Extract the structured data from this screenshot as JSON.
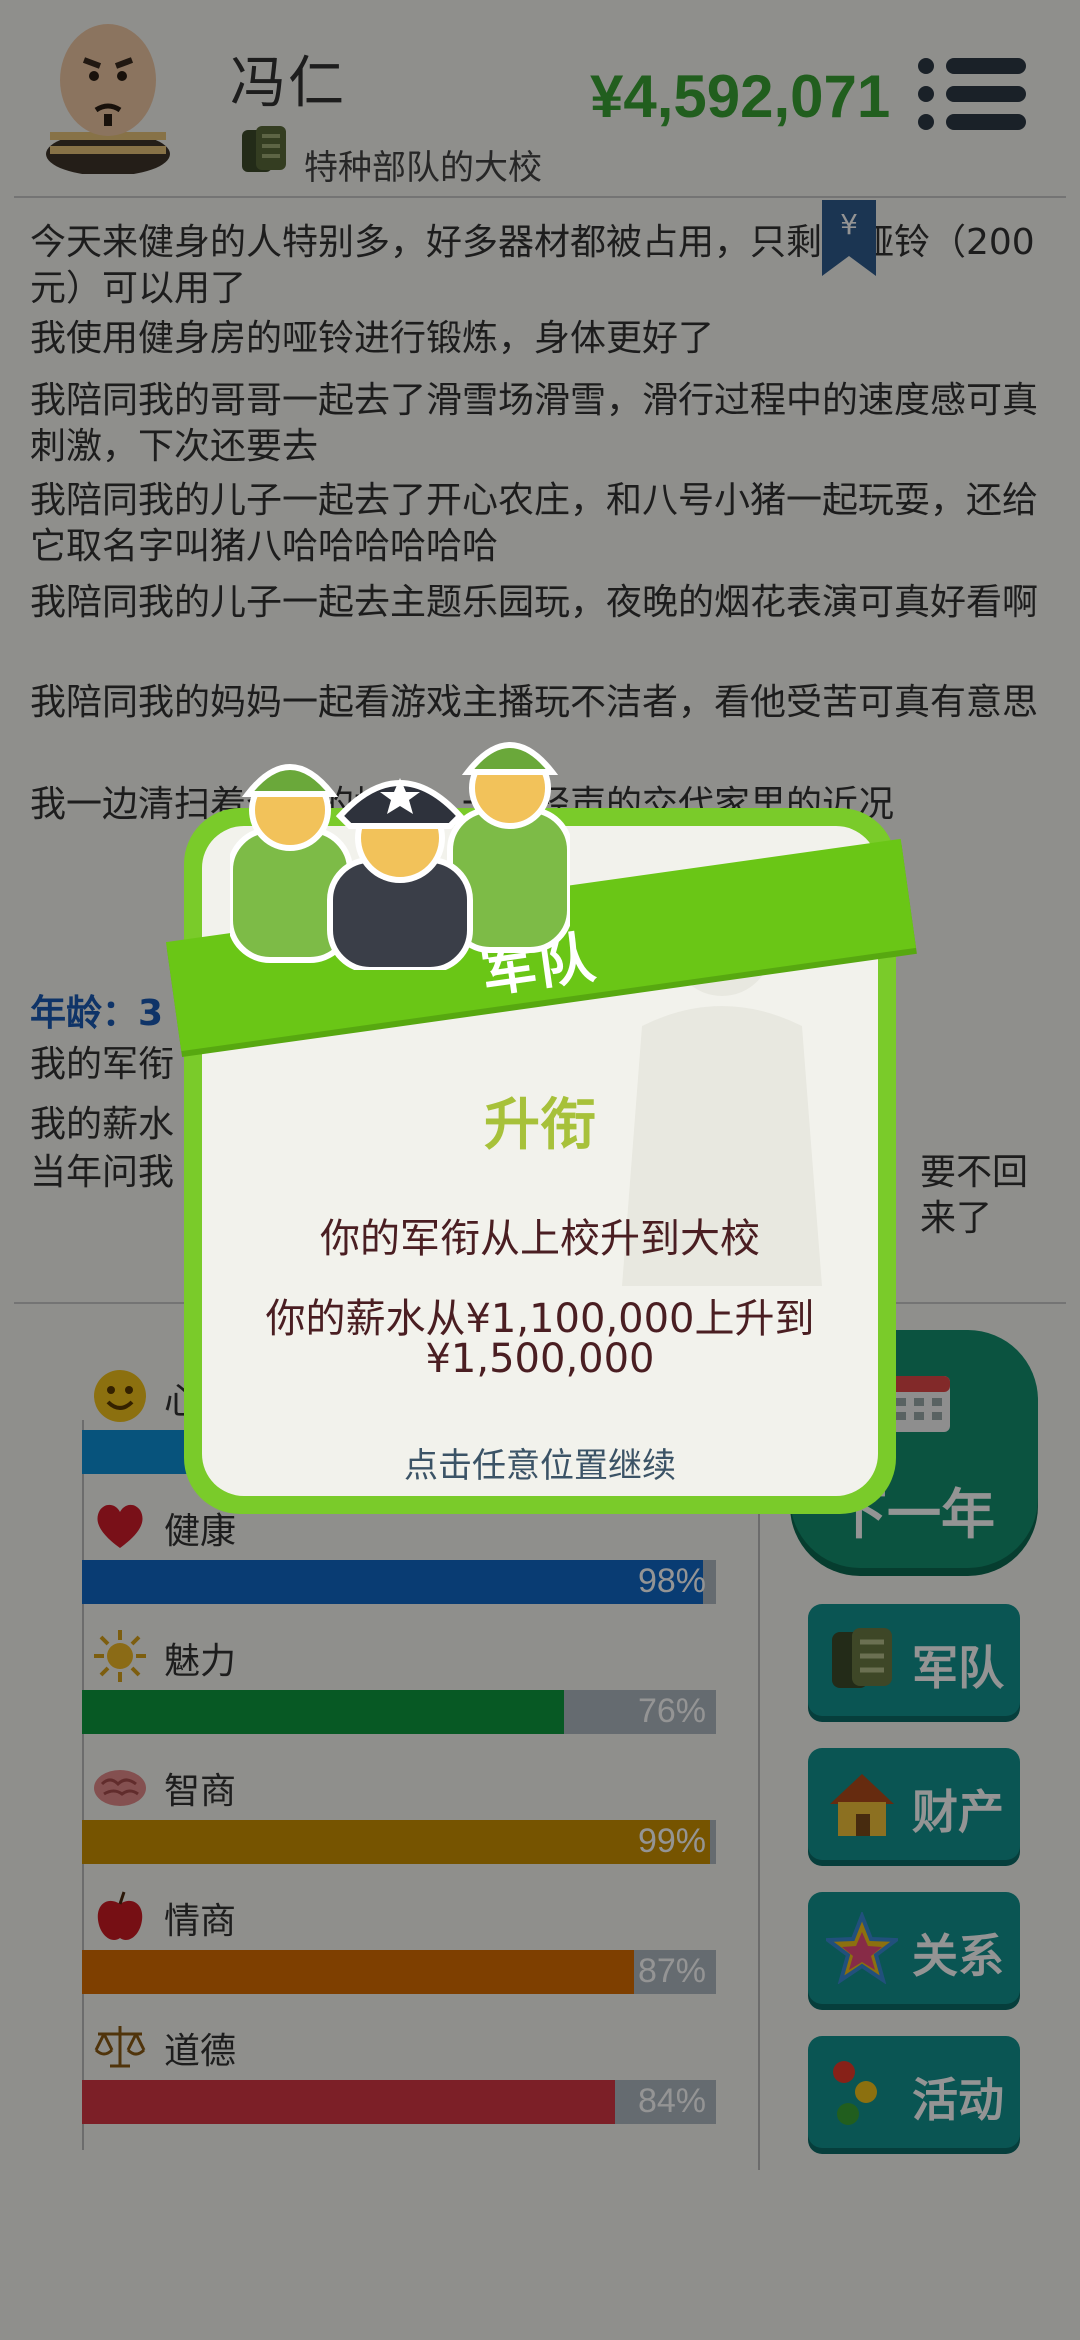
{
  "header": {
    "name": "冯仁",
    "title": "特种部队的大校",
    "money": "¥4,592,071"
  },
  "log": {
    "lines": [
      "今天来健身的人特别多，好多器材都被占用，只剩下哑铃（200元）可以用了",
      "我使用健身房的哑铃进行锻炼，身体更好了",
      "我陪同我的哥哥一起去了滑雪场滑雪，滑行过程中的速度感可真刺激，下次还要去",
      "我陪同我的儿子一起去了开心农庄，和八号小猪一起玩耍，还给它取名字叫猪八哈哈哈哈哈哈",
      "我陪同我的儿子一起去主题乐园玩，夜晚的烟花表演可真好看啊",
      "我陪同我的妈妈一起看游戏主播玩不洁者，看他受苦可真有意思",
      "我一边清扫着爷爷的坟墓，一边轻声的交代家里的近况"
    ],
    "age_label": "年龄：3",
    "lines_after": [
      "我的军衔",
      "我的薪水",
      "当年问我",
      "要不回来了"
    ],
    "bookmark_symbol": "¥"
  },
  "stats": [
    {
      "label": "心情",
      "value": 0.92,
      "pct": "",
      "color": "#0d8fd6",
      "icon": "smiley-icon"
    },
    {
      "label": "健康",
      "value": 0.98,
      "pct": "98%",
      "color": "#1068c6",
      "icon": "heart-icon"
    },
    {
      "label": "魅力",
      "value": 0.76,
      "pct": "76%",
      "color": "#0d9a3e",
      "icon": "sun-icon"
    },
    {
      "label": "智商",
      "value": 0.99,
      "pct": "99%",
      "color": "#cc9200",
      "icon": "brain-icon"
    },
    {
      "label": "情商",
      "value": 0.87,
      "pct": "87%",
      "color": "#d96d00",
      "icon": "apple-icon"
    },
    {
      "label": "道德",
      "value": 0.84,
      "pct": "84%",
      "color": "#d63644",
      "icon": "scales-icon"
    }
  ],
  "side": {
    "next_year": "下一年",
    "buttons": [
      {
        "label": "军队",
        "icon": "military-icon"
      },
      {
        "label": "财产",
        "icon": "house-icon"
      },
      {
        "label": "关系",
        "icon": "star-icon"
      },
      {
        "label": "活动",
        "icon": "dots-icon"
      }
    ]
  },
  "modal": {
    "ribbon": "军队",
    "title": "升衔",
    "line1": "你的军衔从上校升到大校",
    "line2a": "你的薪水从¥1,100,000上升到",
    "line2b": "¥1,500,000",
    "footer": "点击任意位置继续"
  }
}
